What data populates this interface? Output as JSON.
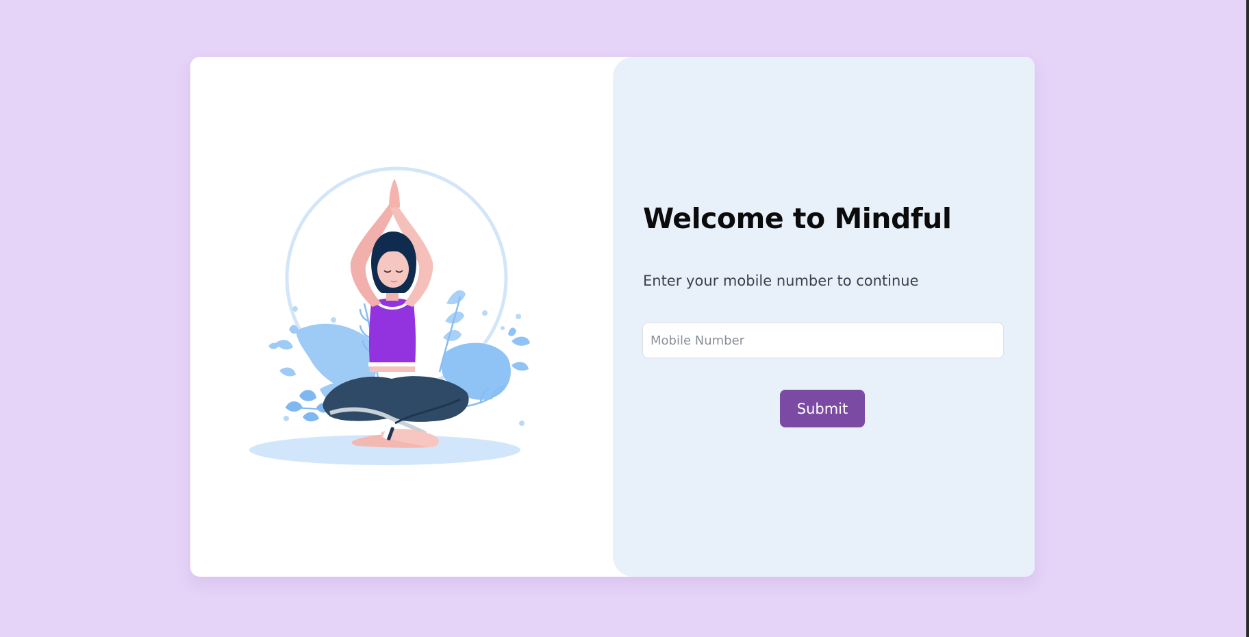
{
  "login": {
    "title": "Welcome to Mindful",
    "subtitle": "Enter your mobile number to continue",
    "mobile_input": {
      "placeholder": "Mobile Number",
      "value": ""
    },
    "submit_label": "Submit"
  },
  "illustration": {
    "icon": "meditation-illustration"
  },
  "colors": {
    "background": "#e6d3f8",
    "panel": "#e8f0fa",
    "accent": "#7b4aa3",
    "top": "#9333e0"
  }
}
